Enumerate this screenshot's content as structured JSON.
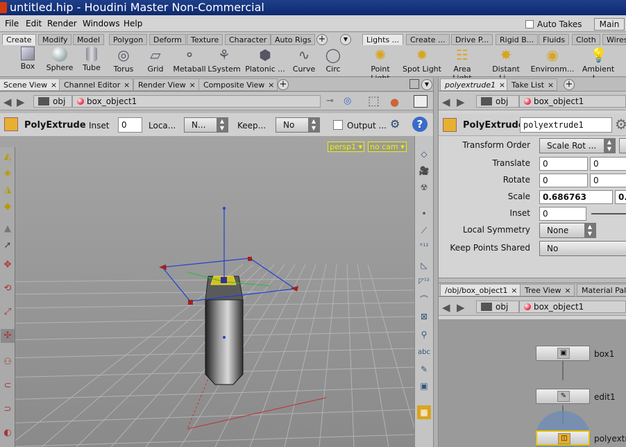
{
  "window": {
    "title": "untitled.hip - Houdini Master Non-Commercial"
  },
  "menubar": {
    "items": [
      "File",
      "Edit",
      "Render",
      "Windows",
      "Help"
    ],
    "auto_takes": "Auto Takes",
    "main": "Main"
  },
  "shelf": {
    "left_tabs": [
      "Create",
      "Modify",
      "Model",
      "Polygon",
      "Deform",
      "Texture",
      "Character",
      "Auto Rigs"
    ],
    "right_tabs": [
      "Lights ...",
      "Create ...",
      "Drive P...",
      "Rigid B...",
      "Fluids",
      "Cloth",
      "Wires"
    ],
    "tools": [
      "Box",
      "Sphere",
      "Tube",
      "Torus",
      "Grid",
      "Metaball",
      "LSystem",
      "Platonic ...",
      "Curve",
      "Circ"
    ],
    "light_tools": [
      "Point Light",
      "Spot Light",
      "Area Light",
      "Distant Li...",
      "Environm...",
      "Ambient L..."
    ]
  },
  "scene": {
    "tabs": [
      "Scene View",
      "Channel Editor",
      "Render View",
      "Composite View"
    ],
    "path_obj": "obj",
    "path_node": "box_object1",
    "op_name": "PolyExtrude",
    "inset_label": "Inset",
    "inset_value": "0",
    "local_label": "Loca...",
    "local_value": "N...",
    "keep_label": "Keep...",
    "keep_value": "No",
    "output_label": "Output ...",
    "cam_persp": "persp1 ▾",
    "cam_nocam": "no cam ▾"
  },
  "params": {
    "tabs": [
      "polyextrude1",
      "Take List"
    ],
    "path_obj": "obj",
    "path_node": "box_object1",
    "op_name": "PolyExtrude",
    "node_name": "polyextrude1",
    "transform_order_label": "Transform Order",
    "transform_order_value": "Scale Rot ...",
    "translate_label": "Translate",
    "translate_x": "0",
    "translate_y": "0",
    "rotate_label": "Rotate",
    "rotate_x": "0",
    "rotate_y": "0",
    "scale_label": "Scale",
    "scale_x": "0.686763",
    "scale_y": "0.",
    "inset_label": "Inset",
    "inset_value": "0",
    "local_symmetry_label": "Local Symmetry",
    "local_symmetry_value": "None",
    "keep_points_label": "Keep Points Shared",
    "keep_points_value": "No"
  },
  "network": {
    "tabs": [
      "/obj/box_object1",
      "Tree View",
      "Material Palet"
    ],
    "path_obj": "obj",
    "path_node": "box_object1",
    "nodes": [
      "box1",
      "edit1",
      "polyextr"
    ]
  }
}
